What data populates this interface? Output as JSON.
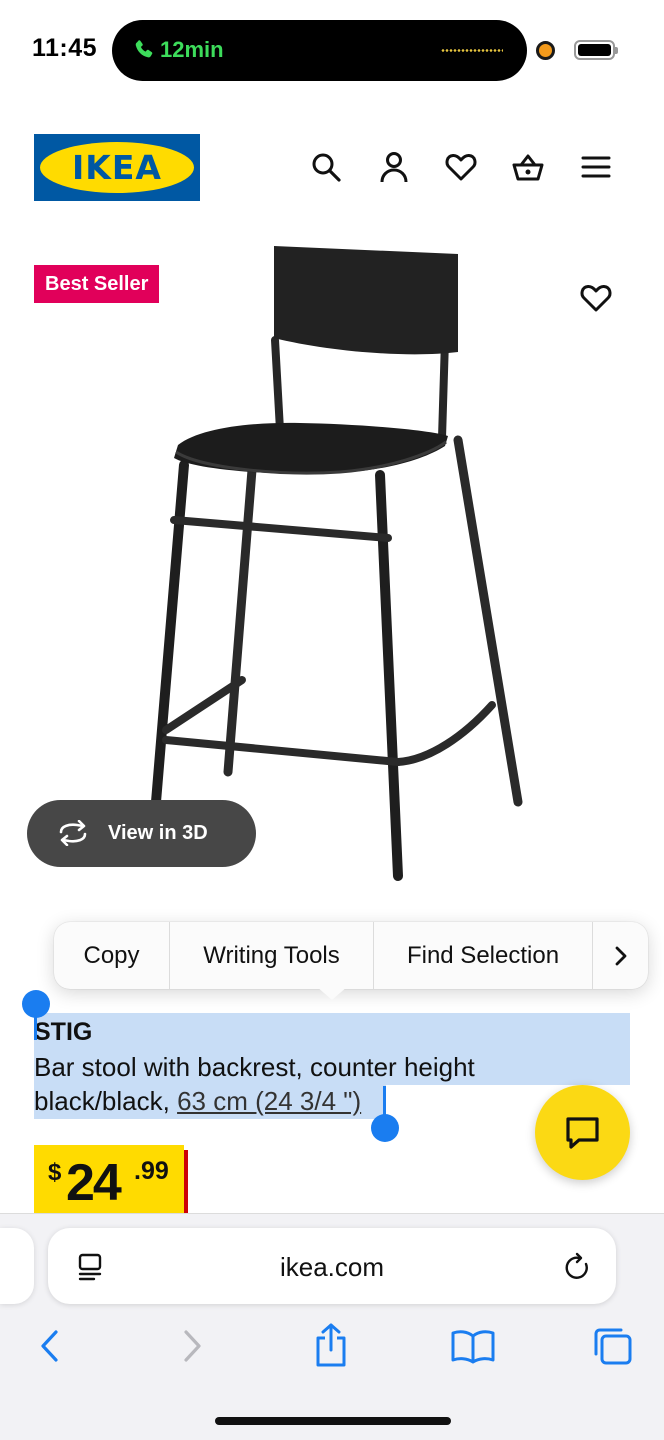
{
  "status_bar": {
    "time": "11:45",
    "call_duration": "12min"
  },
  "header": {
    "logo_text": "IKEA",
    "icons": [
      "search-icon",
      "account-icon",
      "heart-icon",
      "basket-icon",
      "menu-icon"
    ]
  },
  "product": {
    "badge": "Best Seller",
    "view_3d_label": "View in 3D",
    "name": "STIG",
    "description_line1": "Bar stool with backrest, counter height",
    "description_color": "black/black, ",
    "dimension_link": "63 cm (24 3/4 \")",
    "price": {
      "currency": "$",
      "integer": "24",
      "decimal": ".99"
    }
  },
  "context_menu": {
    "items": [
      "Copy",
      "Writing Tools",
      "Find Selection"
    ],
    "more_icon": "chevron-right-icon"
  },
  "browser": {
    "url": "ikea.com"
  },
  "colors": {
    "ikea_blue": "#0058a3",
    "ikea_yellow": "#ffdb00",
    "badge_red": "#e1005a",
    "selection": "#c8ddf6",
    "accent_blue": "#1a7df0"
  }
}
